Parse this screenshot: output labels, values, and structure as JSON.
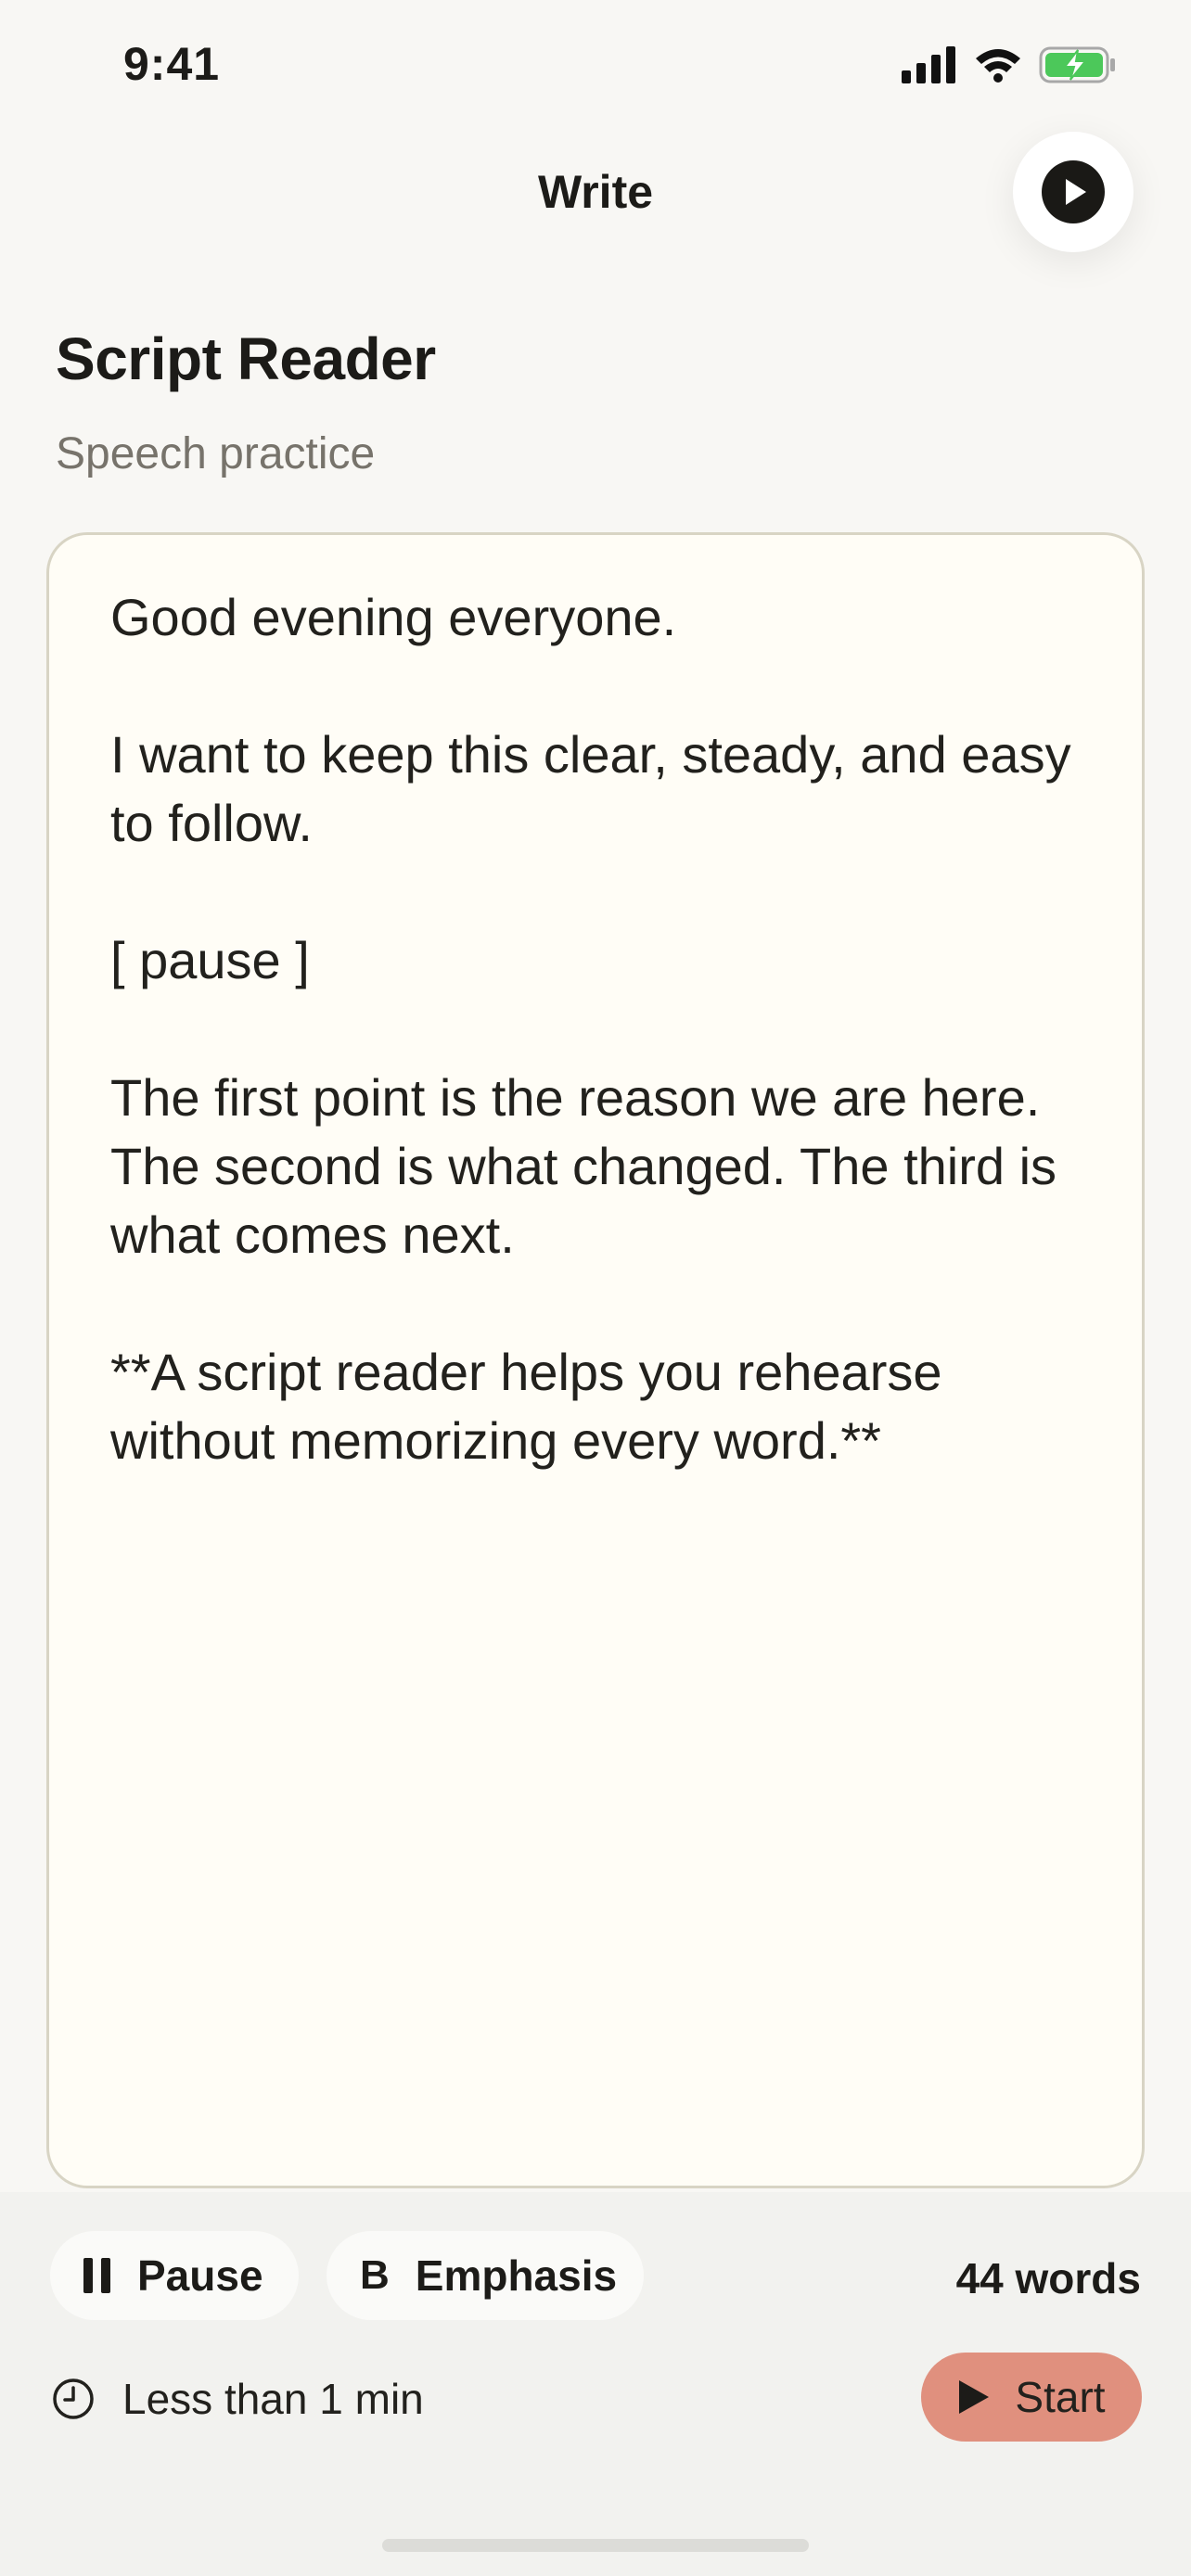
{
  "status_bar": {
    "time": "9:41",
    "battery_color": "#4cc85a"
  },
  "nav": {
    "title": "Write",
    "play_icon": "play-circle-icon"
  },
  "header": {
    "title": "Script Reader",
    "subtitle": "Speech practice"
  },
  "editor": {
    "paragraphs": [
      "Good evening everyone.",
      "I want to keep this clear, steady, and easy to follow.",
      "[ pause ]",
      "The first point is the reason we are here. The second is what changed. The third is what comes next.",
      "**A script reader helps you rehearse without memorizing every word.**"
    ]
  },
  "toolbar": {
    "pause_label": "Pause",
    "emphasis_icon_text": "B",
    "emphasis_label": "Emphasis",
    "word_count": "44 words",
    "duration": "Less than 1 min",
    "start_label": "Start",
    "start_color": "#e0907e"
  }
}
